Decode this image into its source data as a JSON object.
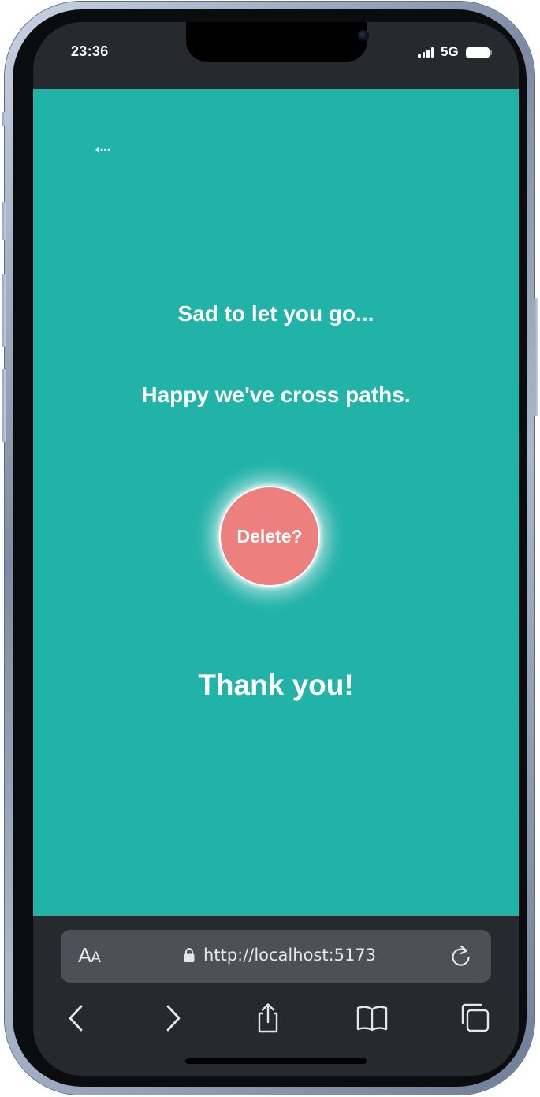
{
  "status_bar": {
    "time": "23:36",
    "network": "5G"
  },
  "page": {
    "back_icon": "back-arrow-icon",
    "line1": "Sad to let you go...",
    "line2": "Happy we've cross paths.",
    "delete_label": "Delete?",
    "thanks": "Thank you!"
  },
  "browser": {
    "text_size_label": "AA",
    "url": "http://localhost:5173",
    "icons": [
      "lock-icon",
      "reload-icon",
      "back-icon",
      "forward-icon",
      "share-icon",
      "bookmarks-icon",
      "tabs-icon"
    ]
  },
  "colors": {
    "background": "#21b2a8",
    "delete_button": "#ee7f7f",
    "chrome": "#262a2f",
    "url_field": "#4d5056"
  }
}
